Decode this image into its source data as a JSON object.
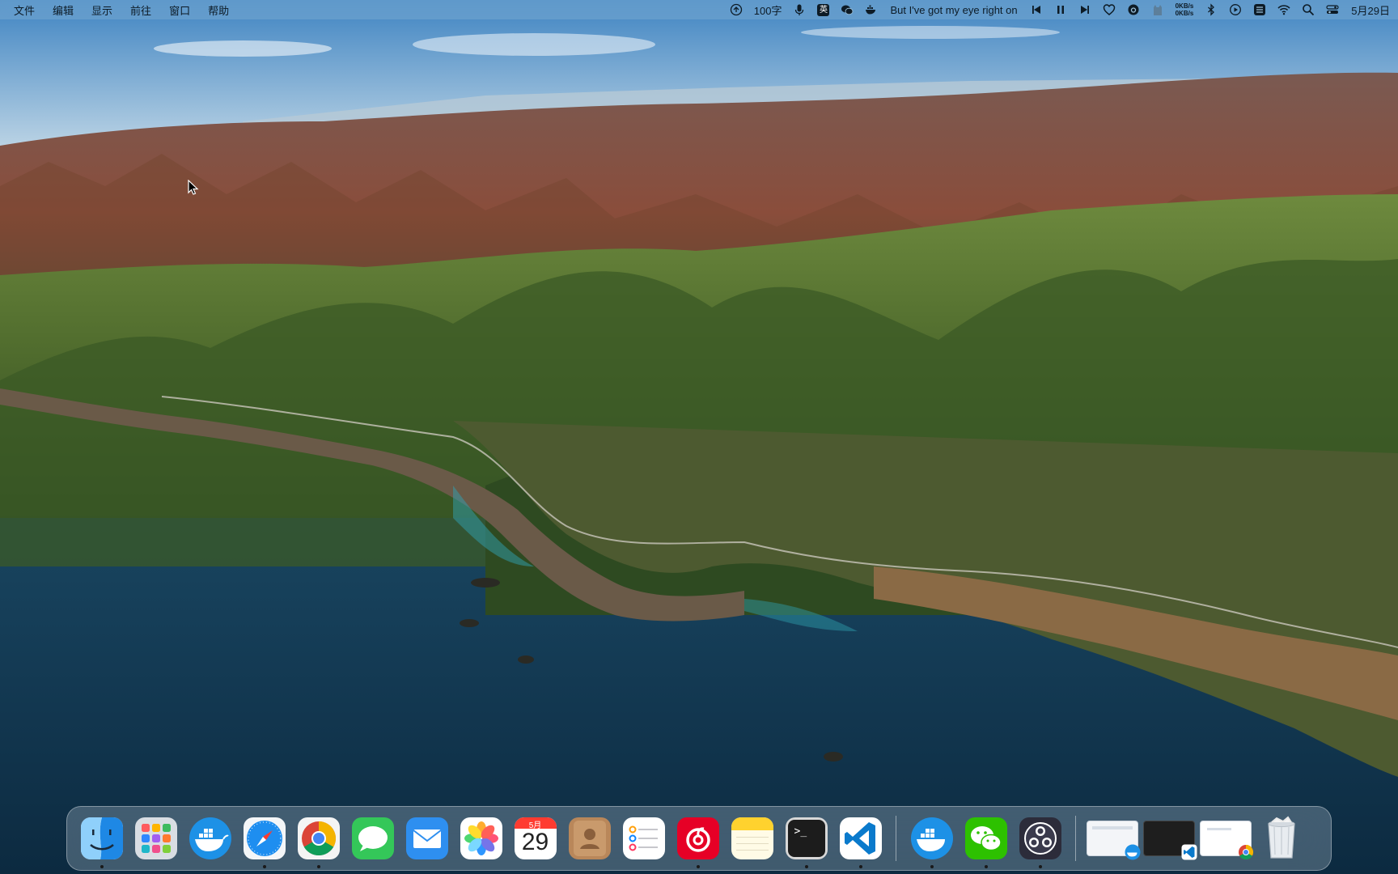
{
  "menubar": {
    "menus": [
      "文件",
      "编辑",
      "显示",
      "前往",
      "窗口",
      "帮助"
    ],
    "word_count": "100字",
    "ime_label": "英",
    "now_playing": "But I've got my eye right on",
    "net_up": "0KB/s",
    "net_down": "0KB/s",
    "clock": "5月29日"
  },
  "dock": {
    "apps": [
      {
        "name": "Finder",
        "icon": "finder-icon",
        "running": true
      },
      {
        "name": "Launchpad",
        "icon": "launchpad-icon",
        "running": false
      },
      {
        "name": "Docker",
        "icon": "docker-icon",
        "running": false
      },
      {
        "name": "Safari",
        "icon": "safari-icon",
        "running": true
      },
      {
        "name": "Google Chrome",
        "icon": "chrome-icon",
        "running": true
      },
      {
        "name": "Messages",
        "icon": "messages-icon",
        "running": false
      },
      {
        "name": "Mail",
        "icon": "mail-icon",
        "running": false
      },
      {
        "name": "Photos",
        "icon": "photos-icon",
        "running": false
      },
      {
        "name": "Calendar",
        "icon": "calendar-icon",
        "running": false
      },
      {
        "name": "Contacts",
        "icon": "contacts-icon",
        "running": false
      },
      {
        "name": "Reminders",
        "icon": "reminders-icon",
        "running": false
      },
      {
        "name": "NetEase Music",
        "icon": "netease-music-icon",
        "running": true
      },
      {
        "name": "Notes",
        "icon": "notes-icon",
        "running": false
      },
      {
        "name": "Terminal",
        "icon": "terminal-icon",
        "running": true
      },
      {
        "name": "Visual Studio Code",
        "icon": "vscode-icon",
        "running": true
      }
    ],
    "recent_apps": [
      {
        "name": "Docker",
        "icon": "docker-icon",
        "running": true
      },
      {
        "name": "WeChat",
        "icon": "wechat-icon",
        "running": true
      },
      {
        "name": "OBS",
        "icon": "obs-icon",
        "running": true
      }
    ],
    "calendar_month": "5月",
    "calendar_day": "29",
    "terminal_prompt": ">_"
  },
  "colors": {
    "menubar_text": "#0d1b26",
    "dock_bg": "rgba(200,215,230,0.28)"
  }
}
